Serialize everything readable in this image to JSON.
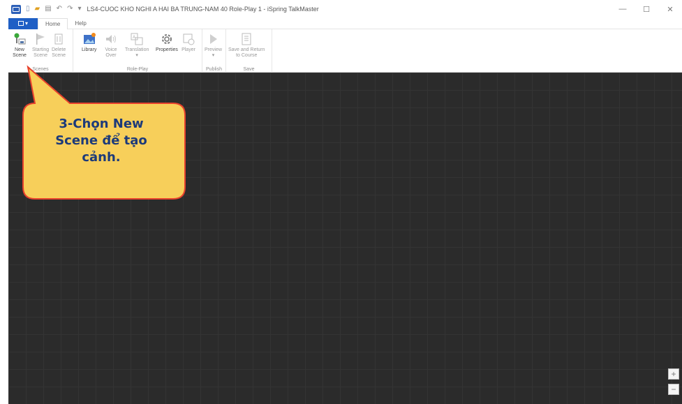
{
  "window": {
    "title": "LS4-CUOC KHO NGHI A HAI BA TRUNG-NAM 40 Role-Play 1 - iSpring TalkMaster",
    "controls": [
      "—",
      "☐",
      "✕"
    ]
  },
  "quick_access": {
    "icons": [
      "new-icon",
      "open-icon",
      "save-icon",
      "undo-icon",
      "redo-icon",
      "customize-icon"
    ]
  },
  "tabs": {
    "file_label": "▾",
    "items": [
      "Home",
      "Help"
    ]
  },
  "ribbon": {
    "groups": [
      {
        "label": "Scenes",
        "buttons": [
          {
            "label": "New\nScene",
            "icon": "new-scene-icon",
            "enabled": true
          },
          {
            "label": "Starting\nScene",
            "icon": "flag-icon",
            "enabled": false
          },
          {
            "label": "Delete\nScene",
            "icon": "trash-icon",
            "enabled": false
          }
        ]
      },
      {
        "label": "Role-Play",
        "buttons": [
          {
            "label": "Library",
            "icon": "library-icon",
            "enabled": true
          },
          {
            "label": "Voice\nOver",
            "icon": "speaker-icon",
            "enabled": false
          },
          {
            "label": "Translation\n▾",
            "icon": "translation-icon",
            "enabled": false
          },
          {
            "label": "Properties",
            "icon": "gear-icon",
            "enabled": true
          },
          {
            "label": "Player",
            "icon": "player-icon",
            "enabled": false
          }
        ]
      },
      {
        "label": "Publish",
        "buttons": [
          {
            "label": "Preview\n▾",
            "icon": "play-icon",
            "enabled": false
          }
        ]
      },
      {
        "label": "Save",
        "buttons": [
          {
            "label": "Save and Return\nto Course",
            "icon": "save-return-icon",
            "enabled": false
          }
        ]
      }
    ]
  },
  "canvas": {
    "zoom_in": "+",
    "zoom_out": "−"
  },
  "callout": {
    "text": "3-Chọn New\nScene để tạo\ncảnh.",
    "fill": "#f7cf5a",
    "border": "#e8412c",
    "text_color": "#1c3a7a"
  }
}
